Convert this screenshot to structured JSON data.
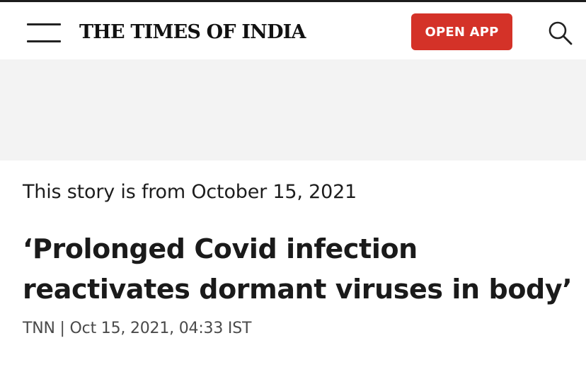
{
  "header": {
    "menu_icon": "hamburger-menu-icon",
    "logo_text": "THE TIMES OF INDIA",
    "open_app_label": "OPEN APP",
    "search_icon": "search-icon",
    "brand_color": "#d43228"
  },
  "article": {
    "story_date_note": "This story is from October 15, 2021",
    "headline": "‘Prolonged Covid infection reactivates dormant viruses in body’",
    "byline": "TNN | Oct 15, 2021, 04:33 IST"
  }
}
